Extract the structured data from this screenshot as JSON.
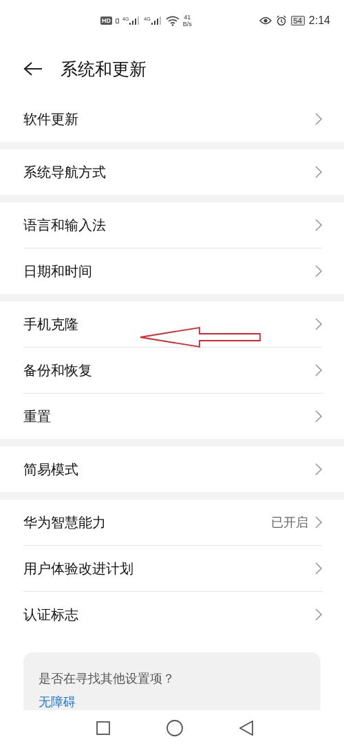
{
  "status_bar": {
    "hd_badge": "HD",
    "signals": [
      {
        "label": "4G"
      },
      {
        "label": "4G"
      }
    ],
    "speed_value": "41",
    "speed_unit": "B/s",
    "battery": "54",
    "time": "2:14"
  },
  "header": {
    "title": "系统和更新"
  },
  "groups": [
    {
      "rows": [
        {
          "label": "软件更新"
        }
      ]
    },
    {
      "rows": [
        {
          "label": "系统导航方式"
        }
      ]
    },
    {
      "rows": [
        {
          "label": "语言和输入法"
        },
        {
          "label": "日期和时间"
        }
      ]
    },
    {
      "rows": [
        {
          "label": "手机克隆"
        },
        {
          "label": "备份和恢复"
        },
        {
          "label": "重置"
        }
      ]
    },
    {
      "rows": [
        {
          "label": "简易模式"
        }
      ]
    },
    {
      "rows": [
        {
          "label": "华为智慧能力",
          "value": "已开启"
        },
        {
          "label": "用户体验改进计划"
        },
        {
          "label": "认证标志"
        }
      ]
    }
  ],
  "hint_card": {
    "question": "是否在寻找其他设置项？",
    "link": "无障碍"
  },
  "annotation": {
    "kind": "arrow"
  }
}
